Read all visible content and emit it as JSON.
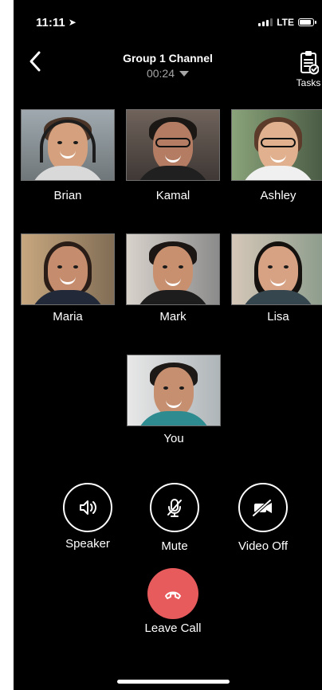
{
  "status_bar": {
    "time": "11:11",
    "location_icon": "location-arrow-icon",
    "network": "LTE"
  },
  "header": {
    "title": "Group 1 Channel",
    "timer": "00:24",
    "tasks_label": "Tasks"
  },
  "participants": [
    {
      "name": "Brian"
    },
    {
      "name": "Kamal"
    },
    {
      "name": "Ashley"
    },
    {
      "name": "Maria"
    },
    {
      "name": "Mark"
    },
    {
      "name": "Lisa"
    },
    {
      "name": "You"
    }
  ],
  "controls": {
    "speaker": "Speaker",
    "mute": "Mute",
    "video_off": "Video Off",
    "leave_call": "Leave Call"
  },
  "colors": {
    "background": "#000000",
    "leave_call": "#e85b5d",
    "timer_text": "#a6a6a6"
  }
}
